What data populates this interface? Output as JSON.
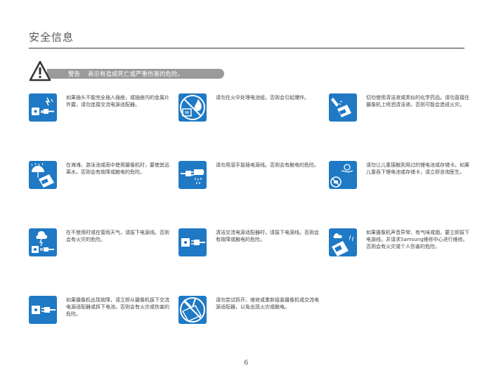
{
  "header": {
    "title": "安全信息"
  },
  "warning": {
    "label": "警告",
    "description": "表示有造成死亡或严重伤害的危险。"
  },
  "items": [
    {
      "icon": "plug-socket-icon",
      "text": "如果插头不能完全插入插座，或插座内的金属片外露，请勿连接交流电源适配器。"
    },
    {
      "icon": "no-fire-battery-icon",
      "text": "请勿在火中处理电池组，否则会引起爆炸。"
    },
    {
      "icon": "no-cleaning-chemicals-icon",
      "text": "切勿使用清洁液或类似的化学药品。请勿直接在摄像机上喷洒清洁液。否则可能会造成火灾。"
    },
    {
      "icon": "rain-camera-icon",
      "text": "在海滩、游泳池或雨中使用摄像机时，要使其远离水。否则会有故障或触电的危险。"
    },
    {
      "icon": "wet-hand-plug-icon",
      "text": "请勿用湿手拔插电源线。否则会有触电的危险。"
    },
    {
      "icon": "child-battery-icon",
      "text": "请勿让儿童接触到用过的锂电池或存储卡。如果儿童吞下锂电池或存储卡，请立即咨询医生。"
    },
    {
      "icon": "lightning-plug-icon",
      "text": "在不使用时或在雷雨天气，请拔下电源线。否则会有火灾的危险。"
    },
    {
      "icon": "unplug-socket-icon",
      "text": "清洁交流电源适配器时，请拔下电源线。否则会有故障或触电的危险。"
    },
    {
      "icon": "smoking-camera-icon",
      "text": "如果摄像机声音异常、有气味或烟，要立即拔下电源线，并请求Samsung维修中心进行维修。否则会有火灾或个人伤害的危险。"
    },
    {
      "icon": "unplug-socket-icon",
      "text": "如果摄像机出现故障，请立即从摄像机拔下交流电源适配器或拆下电池。否则会有火灾或伤害的危险。"
    },
    {
      "icon": "no-disassemble-icon",
      "text": "请勿尝试拆开、维修或重新组装摄像机或交流电源适配器，以免出现火灾或触电。"
    }
  ],
  "footer": {
    "page_number": "6"
  }
}
